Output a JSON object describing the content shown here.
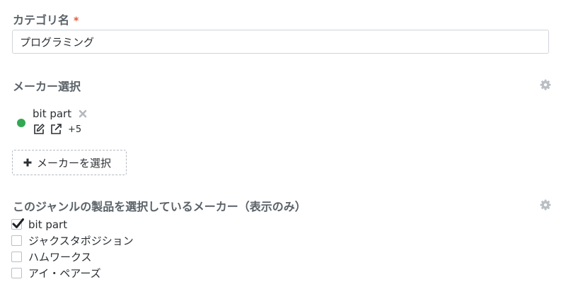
{
  "category": {
    "label": "カテゴリ名",
    "required_mark": "*",
    "value": "プログラミング"
  },
  "maker_select": {
    "label": "メーカー選択",
    "selected": [
      {
        "name": "bit part",
        "status_color": "#33a853",
        "extra_count": "+5"
      }
    ],
    "select_button_label": "メーカーを選択"
  },
  "genre_makers": {
    "label": "このジャンルの製品を選択しているメーカー（表示のみ）",
    "items": [
      {
        "label": "bit part",
        "checked": true
      },
      {
        "label": "ジャクスタポジション",
        "checked": false
      },
      {
        "label": "ハムワークス",
        "checked": false
      },
      {
        "label": "アイ・ペアーズ",
        "checked": false
      }
    ]
  },
  "icons": {
    "settings": "gear-icon",
    "remove": "close-icon",
    "edit": "edit-icon",
    "external": "external-link-icon",
    "add": "plus-icon"
  }
}
